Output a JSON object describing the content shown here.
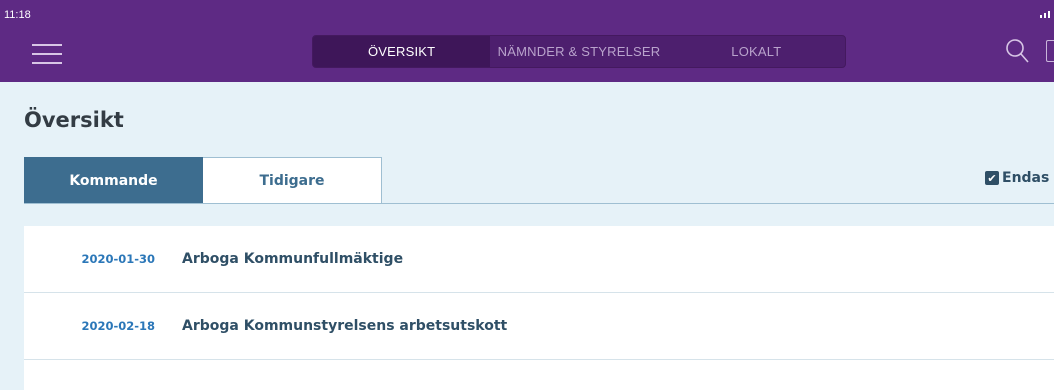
{
  "status_bar": {
    "time": "11:18"
  },
  "nav": {
    "segments": [
      {
        "label": "ÖVERSIKT",
        "active": true
      },
      {
        "label": "NÄMNDER & STYRELSER",
        "active": false
      },
      {
        "label": "LOKALT",
        "active": false
      }
    ],
    "icons": [
      "menu-icon",
      "search-icon"
    ],
    "color": "#5e2a84"
  },
  "page": {
    "title": "Översikt"
  },
  "tabs": [
    {
      "label": "Kommande",
      "active": true
    },
    {
      "label": "Tidigare",
      "active": false
    }
  ],
  "filter": {
    "label": "Endas",
    "checked": true
  },
  "meetings": [
    {
      "date": "2020-01-30",
      "name": "Arboga Kommunfullmäktige"
    },
    {
      "date": "2020-02-18",
      "name": "Arboga Kommunstyrelsens arbetsutskott"
    }
  ],
  "colors": {
    "accent": "#3d6d8f",
    "date": "#2b77b8",
    "background": "#e6f2f8"
  }
}
